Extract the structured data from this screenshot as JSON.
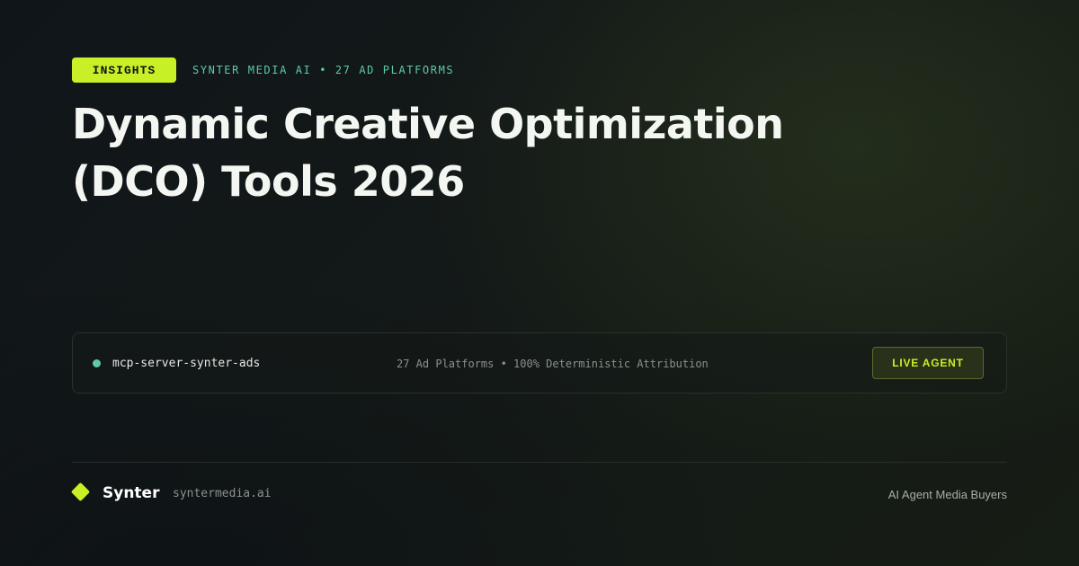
{
  "header": {
    "tag": "INSIGHTS",
    "kicker": "SYNTER MEDIA AI • 27 AD PLATFORMS"
  },
  "title": "Dynamic Creative Optimization (DCO) Tools 2026",
  "panel": {
    "status_color": "#5fc9a8",
    "server_name": "mcp-server-synter-ads",
    "meta": "27 Ad Platforms • 100% Deterministic Attribution",
    "button_label": "LIVE AGENT"
  },
  "footer": {
    "logo_icon": "diamond-icon",
    "brand": "Synter",
    "domain": "syntermedia.ai",
    "tagline": "AI Agent Media Buyers"
  },
  "colors": {
    "accent": "#c8f026",
    "teal": "#5fc9a8",
    "background": "#0f1318"
  }
}
